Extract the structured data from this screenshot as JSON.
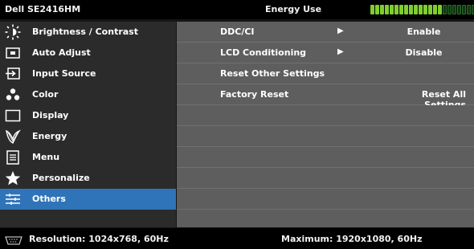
{
  "header": {
    "model": "Dell SE2416HM",
    "title": "Energy Use",
    "energy_meter": {
      "level": 0.7,
      "segments_total": 22,
      "segments_on": 15
    }
  },
  "menu": {
    "items": [
      {
        "label": "Brightness / Contrast",
        "icon": "brightness-icon",
        "active": false
      },
      {
        "label": "Auto Adjust",
        "icon": "auto-adjust-icon",
        "active": false
      },
      {
        "label": "Input Source",
        "icon": "input-source-icon",
        "active": false
      },
      {
        "label": "Color",
        "icon": "color-icon",
        "active": false
      },
      {
        "label": "Display",
        "icon": "display-icon",
        "active": false
      },
      {
        "label": "Energy",
        "icon": "energy-icon",
        "active": false
      },
      {
        "label": "Menu",
        "icon": "menu-icon",
        "active": false
      },
      {
        "label": "Personalize",
        "icon": "star-icon",
        "active": false
      },
      {
        "label": "Others",
        "icon": "sliders-icon",
        "active": true
      }
    ]
  },
  "others": {
    "rows": [
      {
        "label": "DDC/CI",
        "has_submenu": true,
        "value": "Enable"
      },
      {
        "label": "LCD Conditioning",
        "has_submenu": true,
        "value": "Disable"
      },
      {
        "label": "Reset Other Settings",
        "has_submenu": false,
        "value": ""
      },
      {
        "label": "Factory Reset",
        "has_submenu": false,
        "value": "Reset All Settings"
      }
    ]
  },
  "status": {
    "resolution": "Resolution: 1024x768, 60Hz",
    "maximum": "Maximum: 1920x1080, 60Hz"
  },
  "colors": {
    "accent": "#2f74b8",
    "menu_bg": "#2b2b2b",
    "content_bg": "#5e5e5e",
    "meter_on": "#7fce2f",
    "meter_off": "#0d3b0d"
  }
}
